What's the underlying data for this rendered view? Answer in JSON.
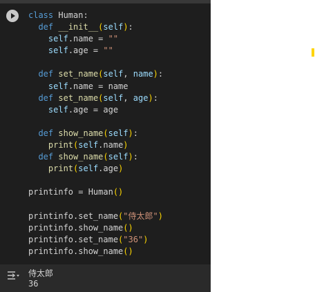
{
  "cell": {
    "run_button_label": "",
    "code_lines": [
      [
        [
          "kw",
          "class"
        ],
        [
          "plain",
          " Human:"
        ]
      ],
      [
        [
          "plain",
          "  "
        ],
        [
          "kw",
          "def"
        ],
        [
          "plain",
          " "
        ],
        [
          "fn",
          "__init__"
        ],
        [
          "paren",
          "("
        ],
        [
          "self",
          "self"
        ],
        [
          "paren",
          ")"
        ],
        [
          "plain",
          ":"
        ]
      ],
      [
        [
          "plain",
          "    "
        ],
        [
          "self",
          "self"
        ],
        [
          "plain",
          ".name = "
        ],
        [
          "str",
          "\"\""
        ]
      ],
      [
        [
          "plain",
          "    "
        ],
        [
          "self",
          "self"
        ],
        [
          "plain",
          ".age = "
        ],
        [
          "str",
          "\"\""
        ]
      ],
      [
        [
          "plain",
          ""
        ]
      ],
      [
        [
          "plain",
          "  "
        ],
        [
          "kw",
          "def"
        ],
        [
          "plain",
          " "
        ],
        [
          "fn",
          "set_name"
        ],
        [
          "paren",
          "("
        ],
        [
          "self",
          "self"
        ],
        [
          "plain",
          ", "
        ],
        [
          "self",
          "name"
        ],
        [
          "paren",
          ")"
        ],
        [
          "plain",
          ":"
        ]
      ],
      [
        [
          "plain",
          "    "
        ],
        [
          "self",
          "self"
        ],
        [
          "plain",
          ".name = name"
        ]
      ],
      [
        [
          "plain",
          "  "
        ],
        [
          "kw",
          "def"
        ],
        [
          "plain",
          " "
        ],
        [
          "fn",
          "set_name"
        ],
        [
          "paren",
          "("
        ],
        [
          "self",
          "self"
        ],
        [
          "plain",
          ", "
        ],
        [
          "self",
          "age"
        ],
        [
          "paren",
          ")"
        ],
        [
          "plain",
          ":"
        ]
      ],
      [
        [
          "plain",
          "    "
        ],
        [
          "self",
          "self"
        ],
        [
          "plain",
          ".age = age"
        ]
      ],
      [
        [
          "plain",
          ""
        ]
      ],
      [
        [
          "plain",
          "  "
        ],
        [
          "kw",
          "def"
        ],
        [
          "plain",
          " "
        ],
        [
          "fn",
          "show_name"
        ],
        [
          "paren",
          "("
        ],
        [
          "self",
          "self"
        ],
        [
          "paren",
          ")"
        ],
        [
          "plain",
          ":"
        ]
      ],
      [
        [
          "plain",
          "    "
        ],
        [
          "fn",
          "print"
        ],
        [
          "paren",
          "("
        ],
        [
          "self",
          "self"
        ],
        [
          "plain",
          ".name"
        ],
        [
          "paren",
          ")"
        ]
      ],
      [
        [
          "plain",
          "  "
        ],
        [
          "kw",
          "def"
        ],
        [
          "plain",
          " "
        ],
        [
          "fn",
          "show_name"
        ],
        [
          "paren",
          "("
        ],
        [
          "self",
          "self"
        ],
        [
          "paren",
          ")"
        ],
        [
          "plain",
          ":"
        ]
      ],
      [
        [
          "plain",
          "    "
        ],
        [
          "fn",
          "print"
        ],
        [
          "paren",
          "("
        ],
        [
          "self",
          "self"
        ],
        [
          "plain",
          ".age"
        ],
        [
          "paren",
          ")"
        ]
      ],
      [
        [
          "plain",
          ""
        ]
      ],
      [
        [
          "plain",
          "printinfo = Human"
        ],
        [
          "paren",
          "()"
        ]
      ],
      [
        [
          "plain",
          ""
        ]
      ],
      [
        [
          "plain",
          "printinfo.set_name"
        ],
        [
          "paren",
          "("
        ],
        [
          "str",
          "\"侍太郎\""
        ],
        [
          "paren",
          ")"
        ]
      ],
      [
        [
          "plain",
          "printinfo.show_name"
        ],
        [
          "paren",
          "()"
        ]
      ],
      [
        [
          "plain",
          "printinfo.set_name"
        ],
        [
          "paren",
          "("
        ],
        [
          "str",
          "\"36\""
        ],
        [
          "paren",
          ")"
        ]
      ],
      [
        [
          "plain",
          "printinfo.show_name"
        ],
        [
          "paren",
          "()"
        ]
      ]
    ]
  },
  "output": {
    "lines": [
      "侍太郎",
      "36"
    ]
  },
  "colors": {
    "keyword": "#569cd6",
    "self": "#9cdcfe",
    "function": "#dcdcaa",
    "string": "#ce9178",
    "paren": "#ffd700",
    "cursor_marker": "#ffd400"
  },
  "icons": {
    "run": "play-circle-icon",
    "output_menu": "output-settings-icon"
  }
}
